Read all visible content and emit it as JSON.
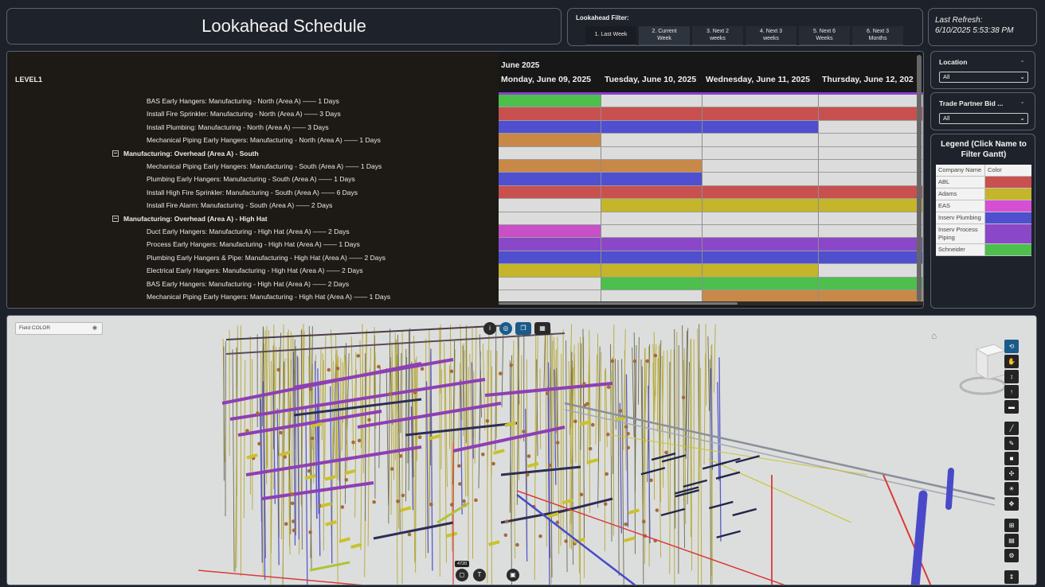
{
  "header": {
    "title": "Lookahead Schedule",
    "refresh_label": "Last Refresh:",
    "refresh_value": "6/10/2025 5:53:38 PM"
  },
  "filter": {
    "label": "Lookahead Filter:",
    "options": [
      {
        "line1": "1. Last Week",
        "line2": ""
      },
      {
        "line1": "2. Current",
        "line2": "Week"
      },
      {
        "line1": "3. Next 2",
        "line2": "weeks"
      },
      {
        "line1": "4. Next 3",
        "line2": "weeks"
      },
      {
        "line1": "5. Next 6",
        "line2": "Weeks"
      },
      {
        "line1": "6. Next 3",
        "line2": "Months"
      }
    ]
  },
  "gantt": {
    "level_header": "LEVEL1",
    "month": "June 2025",
    "days": [
      "Monday, June 09, 2025",
      "Tuesday, June 10, 2025",
      "Wednesday, June 11, 2025",
      "Thursday, June 12, 202"
    ],
    "rows": [
      {
        "label": "BAS Early Hangers: Manufacturing - North (Area A) —— 1 Days",
        "group": false,
        "colors": [
          "#4cbf4c",
          "#dcdcdc",
          "#dcdcdc",
          "#dcdcdc"
        ]
      },
      {
        "label": "Install Fire Sprinkler: Manufacturing - North (Area A) —— 3 Days",
        "group": false,
        "colors": [
          "#c8504f",
          "#c8504f",
          "#c8504f",
          "#c8504f"
        ]
      },
      {
        "label": "Install Plumbing: Manufacturing - North (Area A) —— 3 Days",
        "group": false,
        "colors": [
          "#4f4fcf",
          "#4f4fcf",
          "#4f4fcf",
          "#dcdcdc"
        ]
      },
      {
        "label": "Mechanical Piping Early Hangers: Manufacturing - North (Area A) —— 1 Days",
        "group": false,
        "colors": [
          "#c88848",
          "#dcdcdc",
          "#dcdcdc",
          "#dcdcdc"
        ]
      },
      {
        "label": "Manufacturing: Overhead (Area A) - South",
        "group": true,
        "colors": [
          "#dcdcdc",
          "#dcdcdc",
          "#dcdcdc",
          "#dcdcdc"
        ]
      },
      {
        "label": "Mechanical Piping Early Hangers: Manufacturing - South (Area A) —— 1 Days",
        "group": false,
        "colors": [
          "#c88848",
          "#c88848",
          "#dcdcdc",
          "#dcdcdc"
        ]
      },
      {
        "label": "Plumbing Early Hangers: Manufacturing - South (Area A) —— 1 Days",
        "group": false,
        "colors": [
          "#4f4fcf",
          "#4f4fcf",
          "#dcdcdc",
          "#dcdcdc"
        ]
      },
      {
        "label": "Install High Fire Sprinkler: Manufacturing - South (Area A) —— 6 Days",
        "group": false,
        "colors": [
          "#c8504f",
          "#c8504f",
          "#c8504f",
          "#c8504f"
        ]
      },
      {
        "label": "Install Fire Alarm: Manufacturing - South (Area A) —— 2 Days",
        "group": false,
        "colors": [
          "#dcdcdc",
          "#c5b52a",
          "#c5b52a",
          "#c5b52a"
        ]
      },
      {
        "label": "Manufacturing: Overhead (Area A) - High Hat",
        "group": true,
        "colors": [
          "#dcdcdc",
          "#dcdcdc",
          "#dcdcdc",
          "#dcdcdc"
        ]
      },
      {
        "label": "Duct Early Hangers: Manufacturing - High Hat (Area A) —— 2 Days",
        "group": false,
        "colors": [
          "#c84fc8",
          "#dcdcdc",
          "#dcdcdc",
          "#dcdcdc"
        ]
      },
      {
        "label": "Process Early Hangers: Manufacturing - High Hat (Area A) —— 1 Days",
        "group": false,
        "colors": [
          "#8a48c8",
          "#8a48c8",
          "#8a48c8",
          "#8a48c8"
        ]
      },
      {
        "label": "Plumbing Early Hangers & Pipe: Manufacturing - High Hat (Area A) —— 2 Days",
        "group": false,
        "colors": [
          "#4f4fcf",
          "#4f4fcf",
          "#4f4fcf",
          "#4f4fcf"
        ]
      },
      {
        "label": "Electrical Early Hangers: Manufacturing - High Hat (Area A) —— 2 Days",
        "group": false,
        "colors": [
          "#c5b52a",
          "#c5b52a",
          "#c5b52a",
          "#dcdcdc"
        ]
      },
      {
        "label": "BAS Early Hangers: Manufacturing - High Hat (Area A) —— 2 Days",
        "group": false,
        "colors": [
          "#dcdcdc",
          "#4cbf4c",
          "#4cbf4c",
          "#4cbf4c"
        ]
      },
      {
        "label": "Mechanical Piping Early Hangers: Manufacturing - High Hat (Area A) —— 1 Days",
        "group": false,
        "colors": [
          "#dcdcdc",
          "#dcdcdc",
          "#c88848",
          "#c88848"
        ]
      }
    ]
  },
  "location_slicer": {
    "title": "Location",
    "value": "All"
  },
  "trade_slicer": {
    "title": "Trade Partner Bid ...",
    "value": "All"
  },
  "legend": {
    "title": "Legend (Click Name to Filter Gantt)",
    "col_name": "Company Name",
    "col_color": "Color",
    "items": [
      {
        "name": "ABL",
        "color": "#c8504f"
      },
      {
        "name": "Adams",
        "color": "#c5b52a"
      },
      {
        "name": "EAS",
        "color": "#d44fd4"
      },
      {
        "name": "Inserv Plumbing",
        "color": "#4f4fcf"
      },
      {
        "name": "Inserv Process Piping",
        "color": "#8a48c8"
      },
      {
        "name": "Schneider",
        "color": "#4cbf4c"
      }
    ]
  },
  "viewer": {
    "combo_value": "Field COLOR",
    "count_badge": "4720"
  }
}
